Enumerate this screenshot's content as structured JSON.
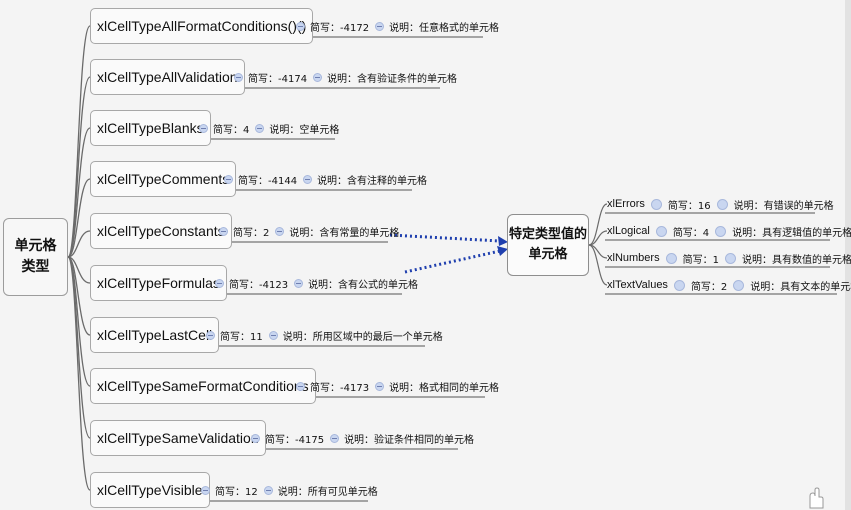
{
  "root": {
    "line1": "单元格",
    "line2": "类型"
  },
  "nodes": [
    {
      "label": "xlCellTypeAllFormatConditions()()",
      "abbr": "简写：-4172",
      "desc": "说明：任意格式的单元格"
    },
    {
      "label": "xlCellTypeAllValidation",
      "abbr": "简写：-4174",
      "desc": "说明：含有验证条件的单元格"
    },
    {
      "label": "xlCellTypeBlanks",
      "abbr": "简写：4",
      "desc": "说明：空单元格"
    },
    {
      "label": "xlCellTypeComments",
      "abbr": "简写：-4144",
      "desc": "说明：含有注释的单元格"
    },
    {
      "label": "xlCellTypeConstants",
      "abbr": "简写：2",
      "desc": "说明：含有常量的单元格"
    },
    {
      "label": "xlCellTypeFormulas",
      "abbr": "简写：-4123",
      "desc": "说明：含有公式的单元格"
    },
    {
      "label": "xlCellTypeLastCell",
      "abbr": "简写：11",
      "desc": "说明：所用区域中的最后一个单元格"
    },
    {
      "label": "xlCellTypeSameFormatConditions",
      "abbr": "简写：-4173",
      "desc": "说明：格式相同的单元格"
    },
    {
      "label": "xlCellTypeSameValidation",
      "abbr": "简写：-4175",
      "desc": "说明：验证条件相同的单元格"
    },
    {
      "label": "xlCellTypeVisible",
      "abbr": "简写：12",
      "desc": "说明：所有可见单元格"
    }
  ],
  "target": {
    "line1": "特定类型值的",
    "line2": "单元格"
  },
  "subs": [
    {
      "label": "xlErrors",
      "abbr": "简写：16",
      "desc": "说明：有错误的单元格"
    },
    {
      "label": "xlLogical",
      "abbr": "简写：4",
      "desc": "说明：具有逻辑值的单元格"
    },
    {
      "label": "xlNumbers",
      "abbr": "简写：1",
      "desc": "说明：具有数值的单元格"
    },
    {
      "label": "xlTextValues",
      "abbr": "简写：2",
      "desc": "说明：具有文本的单元格"
    }
  ],
  "colors": {
    "arrow": "#1f3fae",
    "line": "#5a5a5a",
    "collapse": "#c9d6f0"
  }
}
